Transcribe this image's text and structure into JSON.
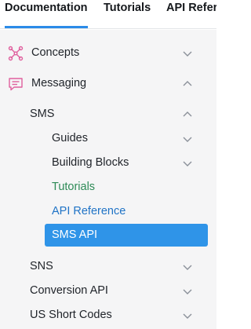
{
  "top_nav": {
    "tabs": [
      {
        "label": "Documentation",
        "active": true
      },
      {
        "label": "Tutorials",
        "active": false
      },
      {
        "label": "API Refer",
        "active": false
      }
    ]
  },
  "sidebar": {
    "items": [
      {
        "label": "Concepts",
        "icon": "concepts-network-icon",
        "expanded": false
      },
      {
        "label": "Messaging",
        "icon": "messaging-chat-icon",
        "expanded": true
      },
      {
        "label": "SMS",
        "expanded": true
      },
      {
        "label": "Guides",
        "expanded": false
      },
      {
        "label": "Building Blocks",
        "expanded": false
      },
      {
        "label": "Tutorials"
      },
      {
        "label": "API Reference"
      },
      {
        "label": "SMS API",
        "selected": true
      },
      {
        "label": "SNS",
        "expanded": false
      },
      {
        "label": "Conversion API",
        "expanded": false
      },
      {
        "label": "US Short Codes",
        "expanded": false
      }
    ]
  },
  "colors": {
    "active_tab_underline": "#2b8be8",
    "selected_item_bg": "#2f94e8",
    "tutorials_link": "#2e8b57",
    "api_reference_link": "#1f73c6",
    "icon_pink": "#e0609e"
  }
}
